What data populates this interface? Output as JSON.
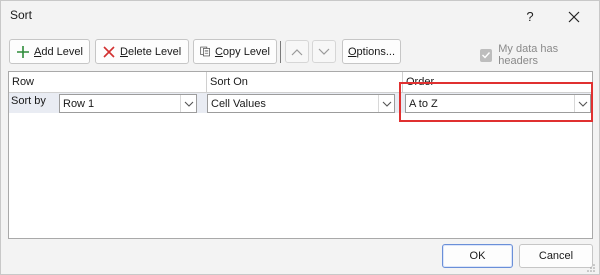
{
  "window": {
    "title": "Sort",
    "help_label": "?"
  },
  "toolbar": {
    "add_level": {
      "underlined": "A",
      "rest": "dd Level"
    },
    "delete_level": {
      "underlined": "D",
      "rest": "elete Level"
    },
    "copy_level": {
      "underlined": "C",
      "rest": "opy Level"
    },
    "options": {
      "underlined": "O",
      "rest": "ptions..."
    },
    "my_data_has_headers": {
      "prefix": "My data has ",
      "underlined": "h",
      "rest": "eaders"
    },
    "headers_checked": true
  },
  "columns": {
    "row": "Row",
    "sort_on": "Sort On",
    "order": "Order"
  },
  "level": {
    "label": "Sort by",
    "row_value": "Row 1",
    "sort_on_value": "Cell Values",
    "order_value": "A to Z"
  },
  "footer": {
    "ok": "OK",
    "cancel": "Cancel"
  },
  "colors": {
    "highlight": "#e03030",
    "add_icon": "#2e8b3a",
    "delete_icon": "#d23030"
  }
}
